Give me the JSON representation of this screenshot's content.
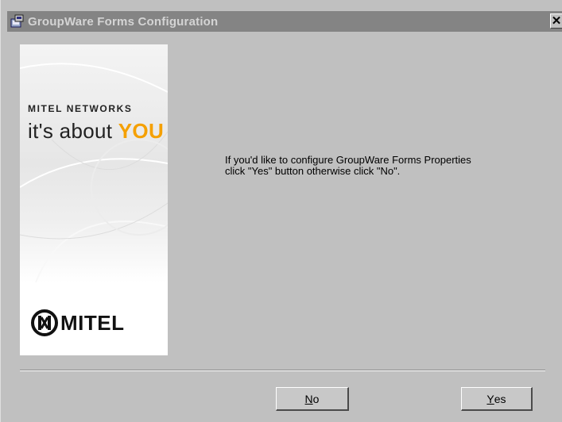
{
  "window": {
    "title": "GroupWare Forms Configuration",
    "close_glyph": "✕"
  },
  "banner": {
    "company": "MITEL NETWORKS",
    "tagline_prefix": "it's about ",
    "tagline_emphasis": "YOU",
    "logo_word": "MITEL",
    "accent_color": "#f5a000"
  },
  "message": {
    "line1": "If you'd like to configure GroupWare Forms Properties",
    "line2": "click \"Yes\" button otherwise click \"No\"."
  },
  "buttons": {
    "no": {
      "mnemonic": "N",
      "rest": "o"
    },
    "yes": {
      "mnemonic": "Y",
      "rest": "es"
    }
  }
}
